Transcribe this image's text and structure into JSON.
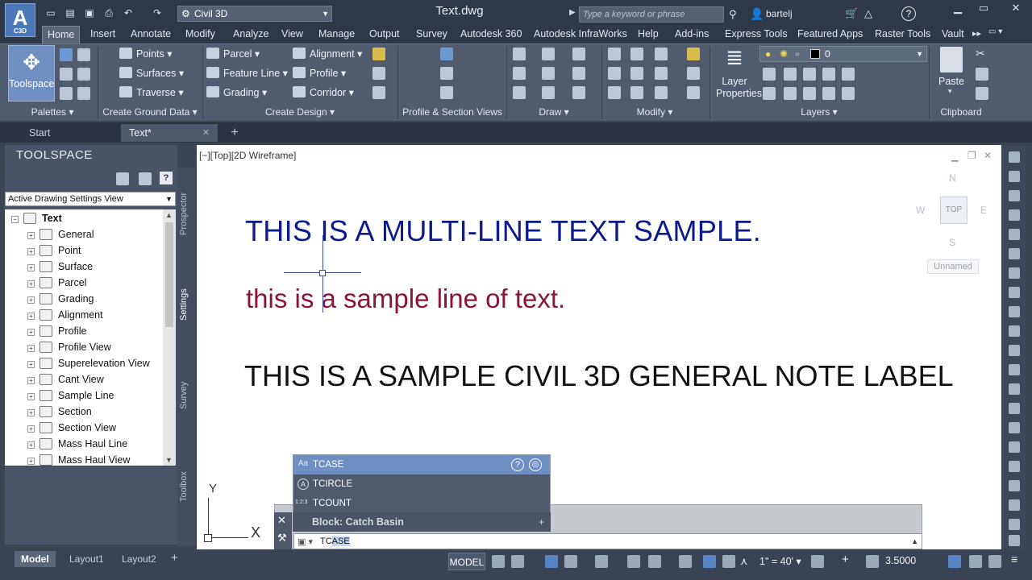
{
  "app": {
    "logo_text": "A",
    "logo_sub": "C3D",
    "workspace": "Civil 3D",
    "document_title": "Text.dwg",
    "search_placeholder": "Type a keyword or phrase",
    "user": "bartelj"
  },
  "ribbon_tabs": [
    "Home",
    "Insert",
    "Annotate",
    "Modify",
    "Analyze",
    "View",
    "Manage",
    "Output",
    "Survey",
    "Autodesk 360",
    "Autodesk InfraWorks",
    "Help",
    "Add-ins",
    "Express Tools",
    "Featured Apps",
    "Raster Tools",
    "Vault"
  ],
  "ribbon": {
    "toolspace_label": "Toolspace",
    "ground": [
      "Points",
      "Surfaces",
      "Traverse"
    ],
    "design_col1": [
      "Parcel",
      "Feature Line",
      "Grading"
    ],
    "design_col2": [
      "Alignment",
      "Profile",
      "Corridor"
    ],
    "layer_properties": [
      "Layer",
      "Properties"
    ],
    "layer_value": "0",
    "paste": "Paste",
    "panels": [
      "Palettes",
      "Create Ground Data",
      "Create Design",
      "Profile & Section Views",
      "Draw",
      "Modify",
      "Layers",
      "Clipboard"
    ]
  },
  "doc_tabs": {
    "start": "Start",
    "text": "Text*"
  },
  "toolspace": {
    "title": "TOOLSPACE",
    "view_select": "Active Drawing Settings View",
    "root": "Text",
    "items": [
      "General",
      "Point",
      "Surface",
      "Parcel",
      "Grading",
      "Alignment",
      "Profile",
      "Profile View",
      "Superelevation View",
      "Cant View",
      "Sample Line",
      "Section",
      "Section View",
      "Mass Haul Line",
      "Mass Haul View"
    ],
    "side_tabs": [
      "Prospector",
      "Settings",
      "Survey",
      "Toolbox"
    ]
  },
  "drawing": {
    "viewport_label": "[−][Top][2D Wireframe]",
    "mtext": "THIS IS A MULTI-LINE TEXT SAMPLE.",
    "line_text": "this is a sample line of text.",
    "note_label": "THIS IS A SAMPLE CIVIL 3D GENERAL NOTE LABEL",
    "viewcube": {
      "n": "N",
      "s": "S",
      "e": "E",
      "w": "W",
      "top": "TOP",
      "ucs": "Unnamed"
    },
    "ucs": {
      "x": "X",
      "y": "Y"
    }
  },
  "autocomplete": {
    "items": [
      "TCASE",
      "TCIRCLE",
      "TCOUNT"
    ],
    "icons": [
      "Aa",
      "A",
      "1:2:3"
    ],
    "block": "Block: Catch Basin"
  },
  "command": {
    "typed": "TC",
    "suggested": "ASE"
  },
  "status": {
    "layout_tabs": [
      "Model",
      "Layout1",
      "Layout2"
    ],
    "model": "MODEL",
    "scale": "1\" = 40'",
    "value": "3.5000"
  }
}
